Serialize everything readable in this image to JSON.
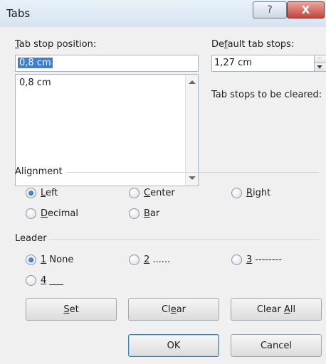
{
  "window": {
    "title": "Tabs"
  },
  "titlebar": {
    "help_glyph": "?",
    "close_glyph": "X"
  },
  "tab_stop": {
    "label_prefix": "",
    "label_mnemonic": "T",
    "label_rest": "ab stop position:",
    "value": "0,8 cm",
    "list_items": [
      "0,8 cm"
    ]
  },
  "default_tabs": {
    "label_prefix": "De",
    "label_mnemonic": "f",
    "label_rest": "ault tab stops:",
    "value": "1,27 cm"
  },
  "cleared": {
    "label": "Tab stops to be cleared:"
  },
  "alignment": {
    "group_label": "Alignment",
    "options": [
      {
        "mnemonic": "L",
        "rest": "eft",
        "checked": true
      },
      {
        "mnemonic": "C",
        "rest": "enter",
        "checked": false
      },
      {
        "mnemonic": "R",
        "rest": "ight",
        "checked": false
      },
      {
        "mnemonic": "D",
        "rest": "ecimal",
        "checked": false
      },
      {
        "mnemonic": "B",
        "rest": "ar",
        "checked": false
      }
    ]
  },
  "leader": {
    "group_label": "Leader",
    "options": [
      {
        "mnemonic": "1",
        "rest": " None",
        "checked": true
      },
      {
        "mnemonic": "2",
        "rest": " ......",
        "checked": false
      },
      {
        "mnemonic": "3",
        "rest": " --------",
        "checked": false
      },
      {
        "mnemonic": "4",
        "rest": " ___",
        "checked": false
      }
    ]
  },
  "buttons": {
    "set": {
      "prefix": "",
      "mnemonic": "S",
      "rest": "et"
    },
    "clear": {
      "prefix": "Cl",
      "mnemonic": "e",
      "rest": "ar"
    },
    "clear_all": {
      "prefix": "Clear ",
      "mnemonic": "A",
      "rest": "ll"
    },
    "ok": "OK",
    "cancel": "Cancel"
  }
}
